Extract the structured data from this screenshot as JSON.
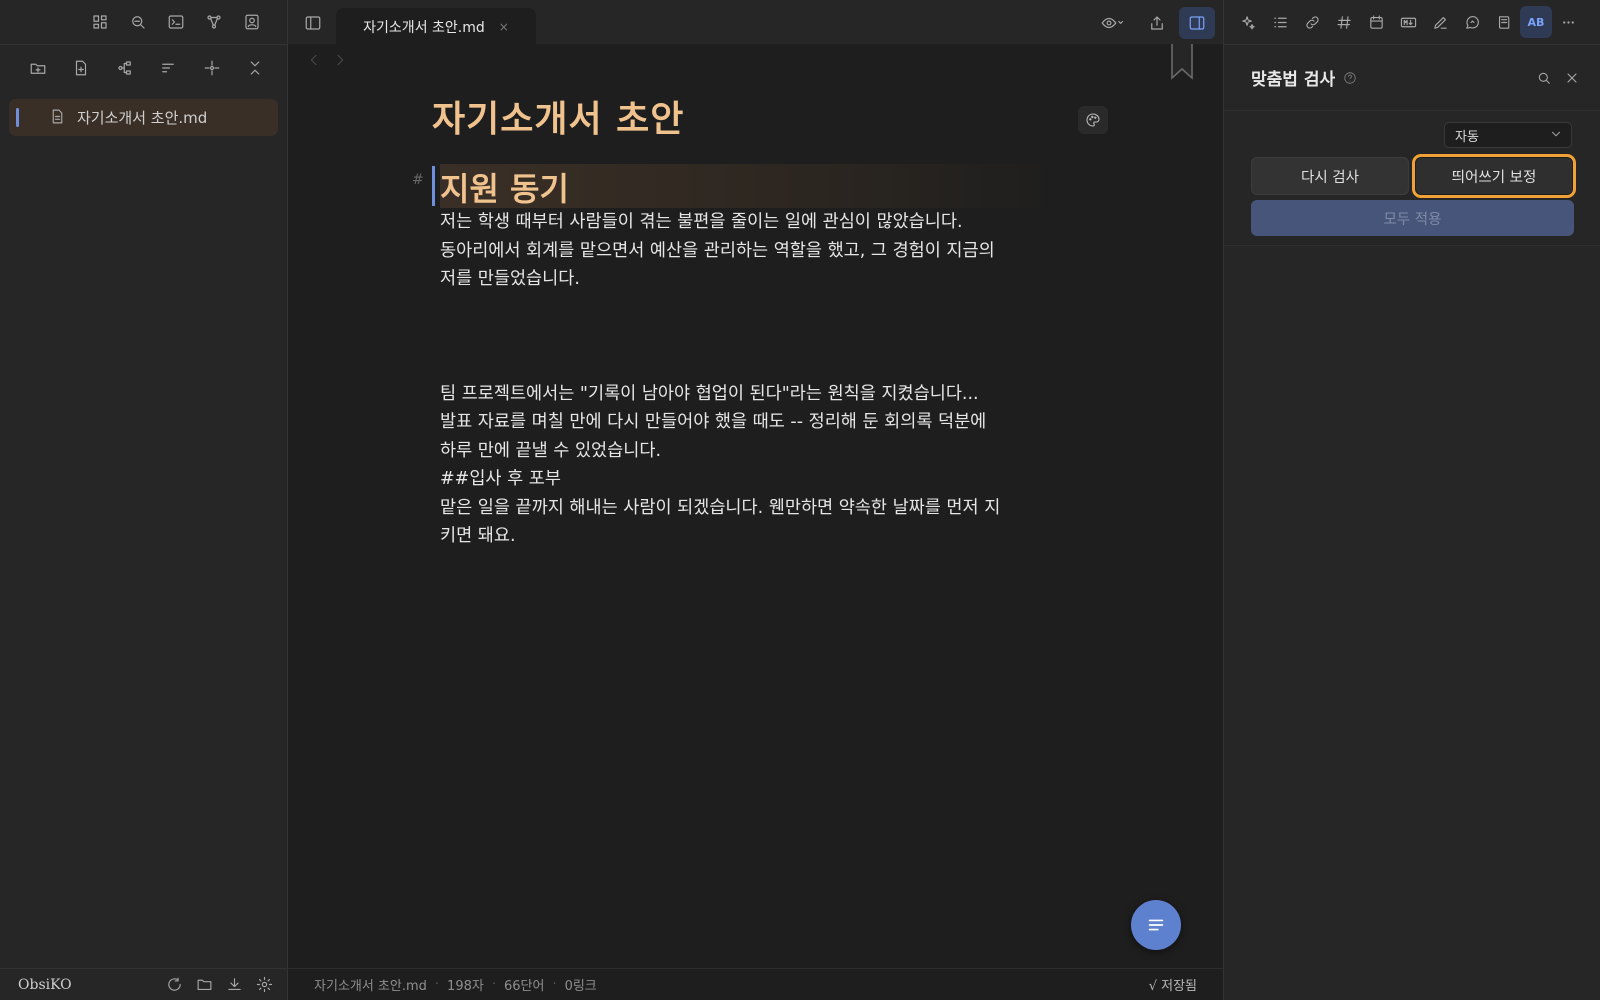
{
  "app": {
    "vault_name": "ObsiKO"
  },
  "file_tree": {
    "items": [
      {
        "label": "자기소개서 초안.md",
        "icon": "file-icon",
        "active": true
      }
    ]
  },
  "tab": {
    "title": "자기소개서 초안.md",
    "close": "×"
  },
  "document": {
    "title": "자기소개서 초안",
    "heading_marker": "#",
    "heading": "지원 동기",
    "paragraph1": [
      "저는 학생 때부터 사람들이 겪는 불편을 줄이는 일에 관심이 많았습니다.",
      "동아리에서 회계를 맡으면서 예산을 관리하는 역할을 했고, 그 경험이 지금의",
      "저를 만들었습니다."
    ],
    "paragraph2": [
      "팀 프로젝트에서는 \"기록이 남아야 협업이 된다\"라는 원칙을 지켰습니다...",
      "발표 자료를 며칠 만에 다시 만들어야 했을 때도 -- 정리해 둔 회의록 덕분에",
      "하루 만에 끝낼 수 있었습니다.",
      "##입사 후 포부",
      "맡은 일을 끝까지 해내는 사람이 되겠습니다. 웬만하면 약속한 날짜를 먼저 지",
      "키면 돼요."
    ]
  },
  "status_bar": {
    "file": "자기소개서 초안.md",
    "chars": "198자",
    "words": "66단어",
    "links": "0링크",
    "saved": "√ 저장됨"
  },
  "right_panel": {
    "title": "맞춤법 검사",
    "mode_value": "자동",
    "recheck_label": "다시 검사",
    "spacing_label": "띄어쓰기 보정",
    "apply_all_label": "모두 적용",
    "active_icon_text": "AB"
  },
  "colors": {
    "accent": "#7aa2f7",
    "title": "#f0c38e",
    "focus_ring": "#f0a236",
    "fab": "#5e81cf"
  }
}
